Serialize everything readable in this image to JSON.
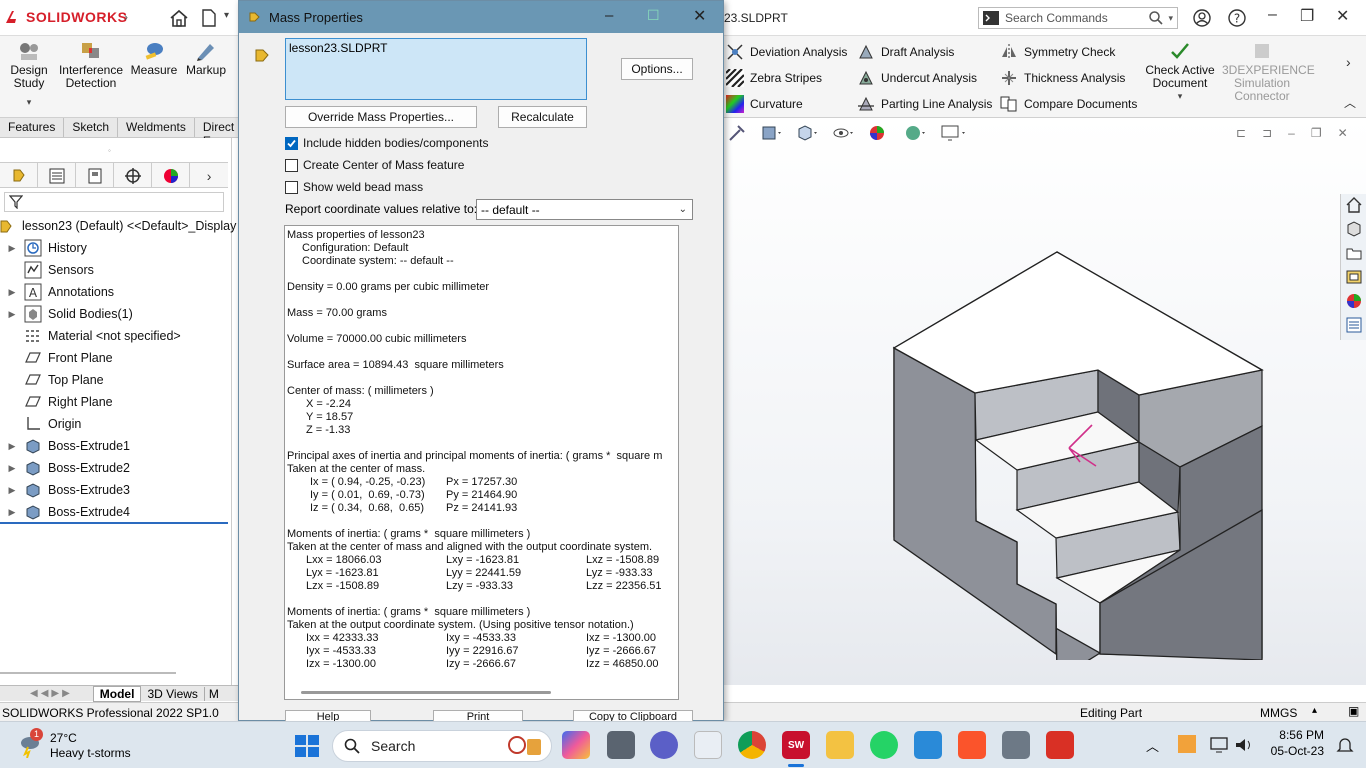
{
  "app": {
    "logo_text": "SOLIDWORKS",
    "doc_title": "23.SLDPRT",
    "search_placeholder": "Search Commands"
  },
  "command_manager": {
    "big_buttons": [
      {
        "label": "Design Study",
        "icon": "design-study-icon"
      },
      {
        "label": "Interference Detection",
        "icon": "interference-icon"
      },
      {
        "label": "Measure",
        "icon": "measure-icon"
      },
      {
        "label": "Markup",
        "icon": "markup-icon"
      }
    ],
    "small_col1": [
      "Deviation Analysis",
      "Zebra Stripes",
      "Curvature"
    ],
    "small_col2": [
      "Draft Analysis",
      "Undercut Analysis",
      "Parting Line Analysis"
    ],
    "small_col3": [
      "Symmetry Check",
      "Thickness Analysis",
      "Compare Documents"
    ],
    "check_active": "Check Active Document",
    "experience": "3DEXPERIENCE Simulation Connector"
  },
  "tabs": [
    "Features",
    "Sketch",
    "Weldments",
    "Direct E"
  ],
  "tree": {
    "root": "lesson23 (Default) <<Default>_Display",
    "items": [
      {
        "label": "History",
        "expandable": true
      },
      {
        "label": "Sensors",
        "expandable": false
      },
      {
        "label": "Annotations",
        "expandable": true
      },
      {
        "label": "Solid Bodies(1)",
        "expandable": true
      },
      {
        "label": "Material <not specified>",
        "expandable": false
      },
      {
        "label": "Front Plane",
        "expandable": false
      },
      {
        "label": "Top Plane",
        "expandable": false
      },
      {
        "label": "Right Plane",
        "expandable": false
      },
      {
        "label": "Origin",
        "expandable": false
      },
      {
        "label": "Boss-Extrude1",
        "expandable": true
      },
      {
        "label": "Boss-Extrude2",
        "expandable": true
      },
      {
        "label": "Boss-Extrude3",
        "expandable": true
      },
      {
        "label": "Boss-Extrude4",
        "expandable": true
      }
    ]
  },
  "bottom_tabs": [
    "Model",
    "3D Views",
    "M"
  ],
  "status": {
    "left": "SOLIDWORKS Professional 2022 SP1.0",
    "mode": "Editing Part",
    "units": "MMGS"
  },
  "dialog": {
    "title": "Mass Properties",
    "selected_item": "lesson23.SLDPRT",
    "options_button": "Options...",
    "override_button": "Override Mass Properties...",
    "recalculate_button": "Recalculate",
    "include_hidden": "Include hidden bodies/components",
    "include_hidden_checked": true,
    "create_com": "Create Center of Mass feature",
    "create_com_checked": false,
    "show_weld": "Show weld bead mass",
    "show_weld_checked": false,
    "report_label": "Report coordinate values relative to:",
    "coord_value": "-- default --",
    "help_button": "Help",
    "print_button": "Print",
    "copy_button": "Copy to Clipboard",
    "results": {
      "header": "Mass properties of lesson23",
      "config": "Configuration: Default",
      "coord": "Coordinate system: -- default --",
      "density": "Density = 0.00 grams per cubic millimeter",
      "mass": "Mass = 70.00 grams",
      "volume": "Volume = 70000.00 cubic millimeters",
      "surface": "Surface area = 10894.43  square millimeters",
      "com_title": "Center of mass: ( millimeters )",
      "com_x": "X = -2.24",
      "com_y": "Y = 18.57",
      "com_z": "Z = -1.33",
      "pa_title": "Principal axes of inertia and principal moments of inertia: ( grams *  square m",
      "pa_taken": "Taken at the center of mass.",
      "ix": "Ix = ( 0.94, -0.25, -0.23)",
      "iy": "Iy = ( 0.01,  0.69, -0.73)",
      "iz": "Iz = ( 0.34,  0.68,  0.65)",
      "px": "Px = 17257.30",
      "py": "Py = 21464.90",
      "pz": "Pz = 24141.93",
      "moi1_title": "Moments of inertia: ( grams *  square millimeters )",
      "moi1_taken": "Taken at the center of mass and aligned with the output coordinate system.",
      "lxx": "Lxx = 18066.03",
      "lxy": "Lxy = -1623.81",
      "lxz": "Lxz = -1508.89",
      "lyx": "Lyx = -1623.81",
      "lyy": "Lyy = 22441.59",
      "lyz": "Lyz = -933.33",
      "lzx": "Lzx = -1508.89",
      "lzy": "Lzy = -933.33",
      "lzz": "Lzz = 22356.51",
      "moi2_title": "Moments of inertia: ( grams *  square millimeters )",
      "moi2_taken": "Taken at the output coordinate system. (Using positive tensor notation.)",
      "ixx": "Ixx = 42333.33",
      "ixy": "Ixy = -4533.33",
      "ixz": "Ixz = -1300.00",
      "iyx": "Iyx = -4533.33",
      "iyy": "Iyy = 22916.67",
      "iyz": "Iyz = -2666.67",
      "izx": "Izx = -1300.00",
      "izy": "Izy = -2666.67",
      "izz": "Izz = 46850.00"
    }
  },
  "taskbar": {
    "weather_temp": "27°C",
    "weather_desc": "Heavy t-storms",
    "weather_badge": "1",
    "search": "Search",
    "time": "8:56 PM",
    "date": "05-Oct-23"
  },
  "colors": {
    "title_bar": "#6a97b4",
    "accent": "#0067c0",
    "logo_red": "#d61f2a"
  }
}
